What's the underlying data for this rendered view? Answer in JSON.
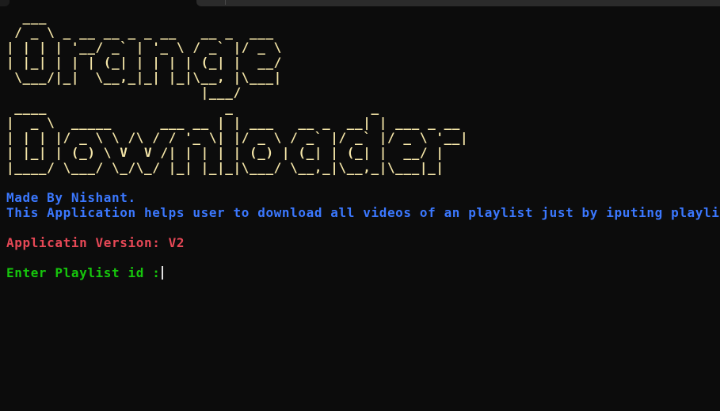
{
  "banner": {
    "title_art": [
      "  ___",
      " / _ \\ _ __ __ _ _ __   __ _  ___",
      "| | | | '__/ _` | '_ \\ / _` |/ _ \\",
      "| |_| | | | (_| | | | | (_| |  __/",
      " \\___/|_|  \\__,_|_| |_|\\__, |\\___|",
      "                        |___/"
    ],
    "subtitle_art": [
      " ____                      _                 _",
      "|  _ \\  _____      ___ __ | | ___   __ _  __| | ___ _ __",
      "| | | |/ _ \\ \\ /\\ / / '_ \\| |/ _ \\ / _` |/ _` |/ _ \\ '__|",
      "| |_| | (_) \\ V  V /| | | | | (_) | (_| | (_| |  __/ |",
      "|____/ \\___/ \\_/\\_/ |_| |_|_|\\___/ \\__,_|\\__,_|\\___|_|"
    ]
  },
  "info": {
    "made_by": "Made By Nishant.",
    "description": "This Application helps user to download all videos of an playlist just by iputing playlist id.",
    "version": "Applicatin Version: V2"
  },
  "prompt": {
    "label": "Enter Playlist id :",
    "value": ""
  },
  "colors": {
    "background": "#0c0c0c",
    "banner": "#f5e6a8",
    "info": "#3b78ff",
    "version": "#e74856",
    "prompt": "#16c60c"
  }
}
